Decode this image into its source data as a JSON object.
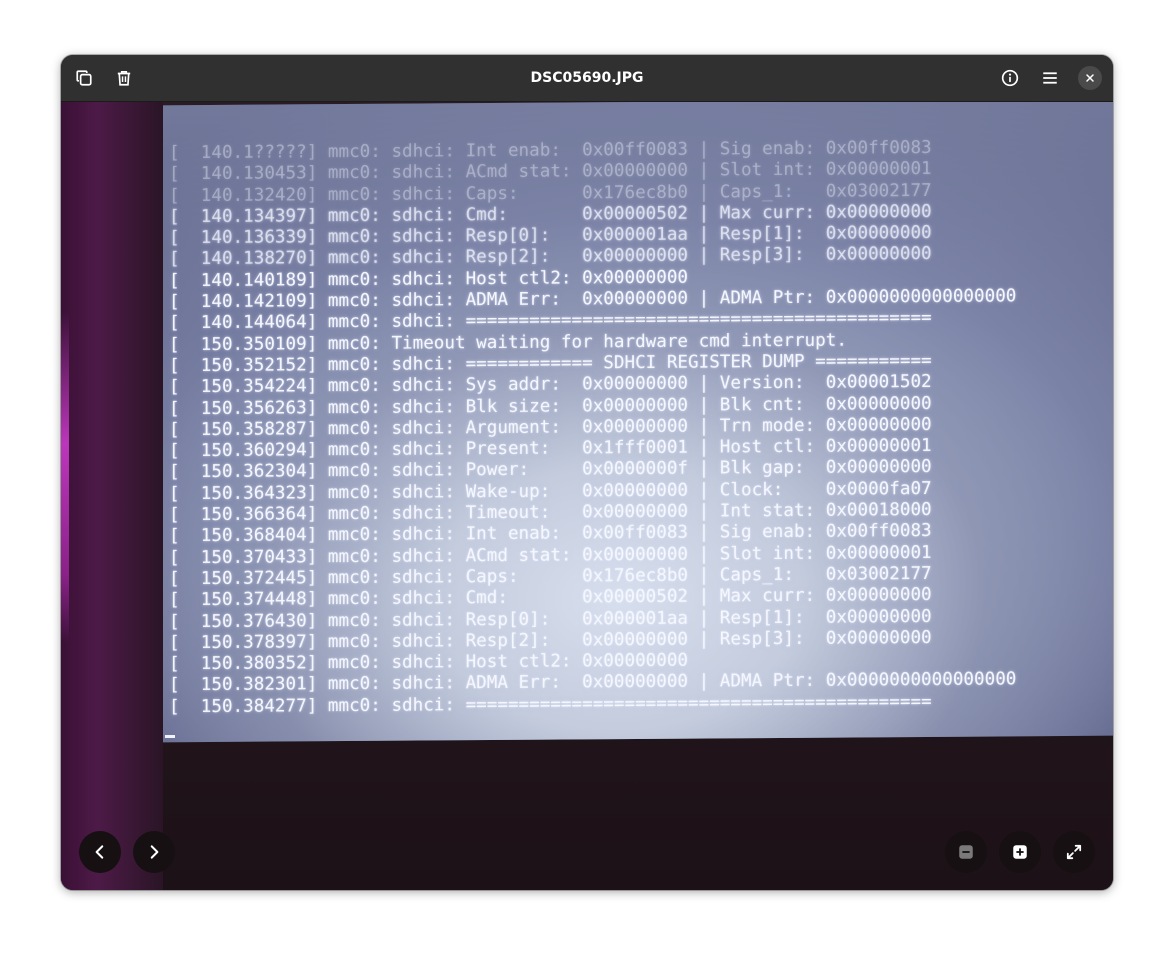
{
  "window": {
    "title": "DSC05690.JPG"
  },
  "headerbar": {
    "copy_icon": "copy-icon",
    "delete_icon": "trash-icon",
    "info_icon": "info-icon",
    "menu_icon": "hamburger-menu-icon",
    "close_icon": "close-icon"
  },
  "controls": {
    "previous_icon": "chevron-left-icon",
    "next_icon": "chevron-right-icon",
    "zoom_out_icon": "zoom-out-icon",
    "zoom_in_icon": "zoom-in-icon",
    "fullscreen_icon": "fullscreen-icon"
  },
  "photo": {
    "console_lines": [
      "[  140.1?????] mmc0: sdhci: Int enab:  0x00ff0083 | Sig enab: 0x00ff0083",
      "[  140.130453] mmc0: sdhci: ACmd stat: 0x00000000 | Slot int: 0x00000001",
      "[  140.132420] mmc0: sdhci: Caps:      0x176ec8b0 | Caps_1:   0x03002177",
      "[  140.134397] mmc0: sdhci: Cmd:       0x00000502 | Max curr: 0x00000000",
      "[  140.136339] mmc0: sdhci: Resp[0]:   0x000001aa | Resp[1]:  0x00000000",
      "[  140.138270] mmc0: sdhci: Resp[2]:   0x00000000 | Resp[3]:  0x00000000",
      "[  140.140189] mmc0: sdhci: Host ctl2: 0x00000000",
      "[  140.142109] mmc0: sdhci: ADMA Err:  0x00000000 | ADMA Ptr: 0x0000000000000000",
      "[  140.144064] mmc0: sdhci: ============================================",
      "[  150.350109] mmc0: Timeout waiting for hardware cmd interrupt.",
      "[  150.352152] mmc0: sdhci: ============ SDHCI REGISTER DUMP ===========",
      "[  150.354224] mmc0: sdhci: Sys addr:  0x00000000 | Version:  0x00001502",
      "[  150.356263] mmc0: sdhci: Blk size:  0x00000000 | Blk cnt:  0x00000000",
      "[  150.358287] mmc0: sdhci: Argument:  0x00000000 | Trn mode: 0x00000000",
      "[  150.360294] mmc0: sdhci: Present:   0x1fff0001 | Host ctl: 0x00000001",
      "[  150.362304] mmc0: sdhci: Power:     0x0000000f | Blk gap:  0x00000000",
      "[  150.364323] mmc0: sdhci: Wake-up:   0x00000000 | Clock:    0x0000fa07",
      "[  150.366364] mmc0: sdhci: Timeout:   0x00000000 | Int stat: 0x00018000",
      "[  150.368404] mmc0: sdhci: Int enab:  0x00ff0083 | Sig enab: 0x00ff0083",
      "[  150.370433] mmc0: sdhci: ACmd stat: 0x00000000 | Slot int: 0x00000001",
      "[  150.372445] mmc0: sdhci: Caps:      0x176ec8b0 | Caps_1:   0x03002177",
      "[  150.374448] mmc0: sdhci: Cmd:       0x00000502 | Max curr: 0x00000000",
      "[  150.376430] mmc0: sdhci: Resp[0]:   0x000001aa | Resp[1]:  0x00000000",
      "[  150.378397] mmc0: sdhci: Resp[2]:   0x00000000 | Resp[3]:  0x00000000",
      "[  150.380352] mmc0: sdhci: Host ctl2: 0x00000000",
      "[  150.382301] mmc0: sdhci: ADMA Err:  0x00000000 | ADMA Ptr: 0x0000000000000000",
      "[  150.384277] mmc0: sdhci: ============================================"
    ]
  }
}
